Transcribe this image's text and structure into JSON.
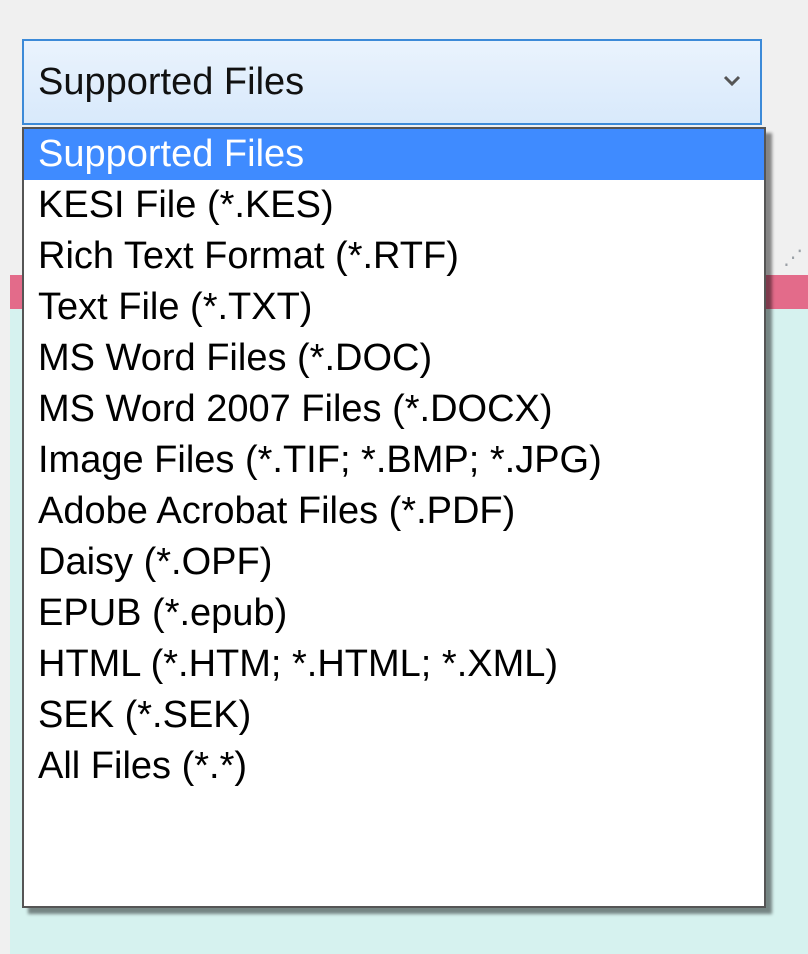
{
  "combo": {
    "selected_value": "Supported Files"
  },
  "options": [
    "Supported Files",
    "KESI File (*.KES)",
    "Rich Text Format (*.RTF)",
    "Text File (*.TXT)",
    "MS Word Files (*.DOC)",
    "MS Word 2007 Files (*.DOCX)",
    "Image Files (*.TIF; *.BMP; *.JPG)",
    "Adobe Acrobat Files (*.PDF)",
    "Daisy (*.OPF)",
    "EPUB (*.epub)",
    "HTML (*.HTM; *.HTML; *.XML)",
    "SEK (*.SEK)",
    "All Files (*.*)"
  ],
  "selected_index": 0,
  "icons": {
    "combo_arrow": "chevron-down-icon"
  },
  "colors": {
    "highlight": "#3f8bff",
    "combo_border": "#3c8ad8",
    "background_strip": "#e36b8a",
    "background_panel": "#d6f2ef"
  }
}
